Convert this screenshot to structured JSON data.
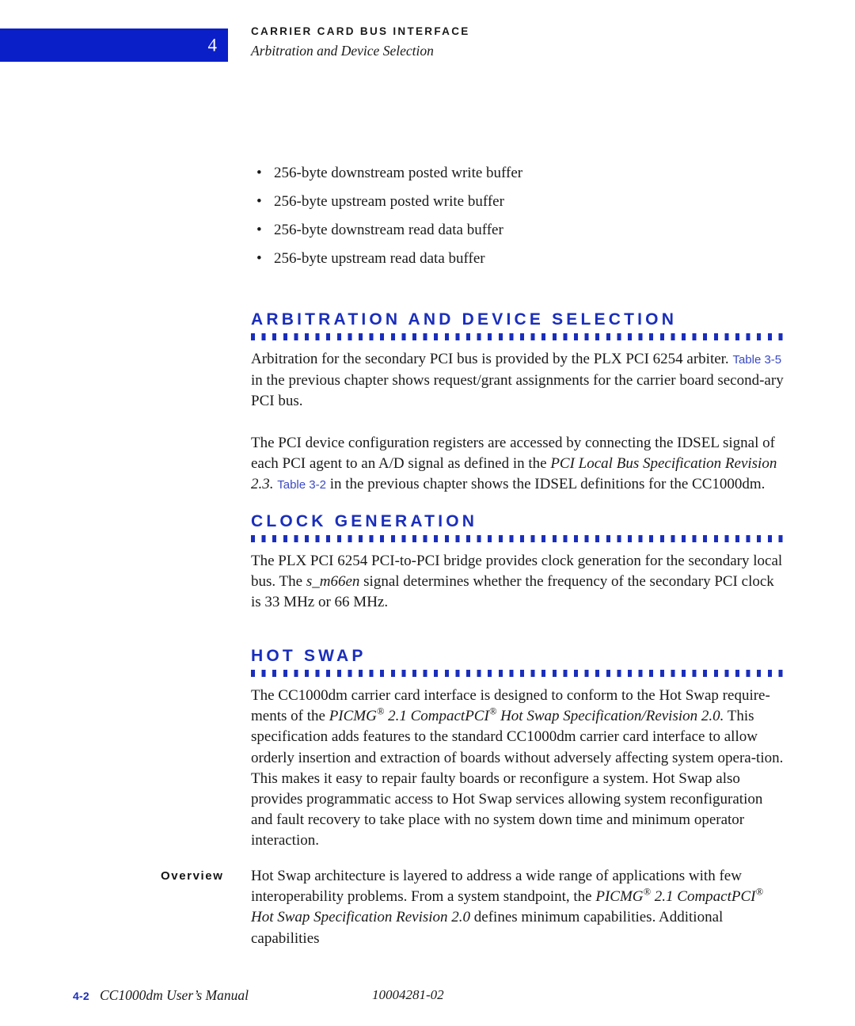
{
  "colors": {
    "chapter_tab_blue": "#0b1fc8",
    "heading_blue": "#1a2ebc",
    "xref_blue": "#3a49c4",
    "body_text": "#1a1a1a",
    "page_background": "#ffffff"
  },
  "header": {
    "chapter_number": "4",
    "title": "CARRIER CARD BUS INTERFACE",
    "subtitle": "Arbitration and Device Selection"
  },
  "bullets": [
    "256-byte downstream posted write buffer",
    "256-byte upstream posted write buffer",
    "256-byte downstream read data buffer",
    "256-byte upstream read data buffer"
  ],
  "sections": [
    {
      "heading": "ARBITRATION AND DEVICE SELECTION",
      "paragraphs": {
        "p1": {
          "a": "Arbitration for the secondary PCI bus is provided by the PLX PCI 6254 arbiter. ",
          "xref": "Table 3-5",
          "b": " in the previous chapter shows request/grant assignments for the carrier board second-ary PCI bus."
        },
        "p2": {
          "a": "The PCI device configuration registers are accessed by connecting the IDSEL signal of each PCI agent to an A/D signal as defined in the ",
          "italic": "PCI Local Bus Specification Revision 2.3.",
          "b": " ",
          "xref": "Table 3-2",
          "c": " in the previous chapter shows the IDSEL definitions for the CC1000dm."
        }
      }
    },
    {
      "heading": "CLOCK GENERATION",
      "paragraphs": {
        "p1": {
          "a": "The PLX PCI 6254 PCI-to-PCI bridge provides clock generation for the secondary local bus. The ",
          "italic": "s_m66en",
          "b": " signal determines whether the frequency of the secondary PCI clock is 33 MHz or 66 MHz."
        }
      }
    },
    {
      "heading": "HOT SWAP",
      "paragraphs": {
        "p1": {
          "a": "The CC1000dm carrier card interface is designed to conform to the Hot Swap require-ments of the ",
          "italic_1": "PICMG",
          "reg_1": "®",
          "italic_2": " 2.1 CompactPCI",
          "reg_2": "®",
          "italic_3": " Hot Swap Specification/Revision 2.0.",
          "b": " This specification adds features to the standard CC1000dm carrier card interface to allow orderly insertion and extraction of boards without adversely affecting system opera-tion. This makes it easy to repair faulty boards or reconfigure a system. Hot Swap also provides programmatic access to Hot Swap services allowing system reconfiguration and fault recovery to take place with no system down time and minimum operator interaction."
        }
      }
    }
  ],
  "overview": {
    "label": "Overview",
    "paragraph": {
      "a": "Hot Swap architecture is layered to address a wide range of applications with few interoperability problems. From a system standpoint, the ",
      "italic_1": "PICMG",
      "reg_1": "®",
      "italic_2": " 2.1 CompactPCI",
      "reg_2": "®",
      "italic_3": " Hot Swap Specification Revision 2.0",
      "b": " defines minimum capabilities. Additional capabilities"
    }
  },
  "footer": {
    "folio": "4-2",
    "manual_title": "CC1000dm User’s Manual",
    "document_number": "10004281-02"
  }
}
